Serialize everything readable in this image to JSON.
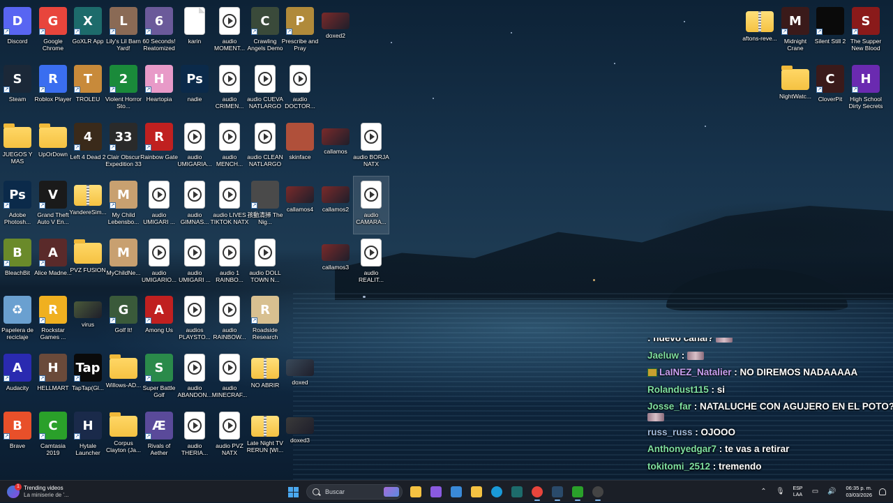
{
  "desktop": {
    "icons": [
      {
        "label": "Discord",
        "type": "app",
        "color": "#5865F2",
        "glyph": "D",
        "shortcut": true
      },
      {
        "label": "Google Chrome",
        "type": "app",
        "color": "#e8453c",
        "glyph": "G",
        "shortcut": true
      },
      {
        "label": "GoXLR App",
        "type": "app",
        "color": "#1d6b6b",
        "glyph": "X",
        "shortcut": true
      },
      {
        "label": "Lily's Lil Barn Yard!",
        "type": "app",
        "color": "#8a6a55",
        "glyph": "L",
        "shortcut": true
      },
      {
        "label": "60 Seconds! Reatomized",
        "type": "app",
        "color": "#6b5a9a",
        "glyph": "6",
        "shortcut": true
      },
      {
        "label": "karin",
        "type": "file",
        "color": "#ffffff",
        "glyph": ""
      },
      {
        "label": "audio MOMENT...",
        "type": "audio",
        "color": "#ffffff",
        "glyph": ""
      },
      {
        "label": "Crawling Angels Demo",
        "type": "app",
        "color": "#3a4a3a",
        "glyph": "C",
        "shortcut": true
      },
      {
        "label": "Prescribe and Pray",
        "type": "app",
        "color": "#b08a3a",
        "glyph": "P",
        "shortcut": true
      },
      {
        "label": "doxed2",
        "type": "thumb",
        "color": "#7a2a2a",
        "glyph": ""
      },
      {
        "label": "Steam",
        "type": "app",
        "color": "#1b2838",
        "glyph": "S",
        "shortcut": true
      },
      {
        "label": "Roblox Player",
        "type": "app",
        "color": "#3a6ef0",
        "glyph": "R",
        "shortcut": true
      },
      {
        "label": "TROLEU",
        "type": "app",
        "color": "#c88a3a",
        "glyph": "T",
        "shortcut": true
      },
      {
        "label": "Violent Horror Sto...",
        "type": "app",
        "color": "#1a8a3a",
        "glyph": "2",
        "shortcut": true
      },
      {
        "label": "Heartopia",
        "type": "app",
        "color": "#e89ac8",
        "glyph": "H",
        "shortcut": true
      },
      {
        "label": "nadie",
        "type": "app",
        "color": "#0b2a4a",
        "glyph": "Ps"
      },
      {
        "label": "audio CRIMEN...",
        "type": "audio",
        "color": "#ffffff",
        "glyph": ""
      },
      {
        "label": "audio CUEVA NATLARGO",
        "type": "audio",
        "color": "#ffffff",
        "glyph": ""
      },
      {
        "label": "audio DOCTOR...",
        "type": "audio",
        "color": "#ffffff",
        "glyph": ""
      },
      {
        "label": "JUEGOS Y MAS",
        "type": "folder",
        "color": "#f5c242",
        "glyph": ""
      },
      {
        "label": "UpOrDown",
        "type": "folder",
        "color": "#f5c242",
        "glyph": ""
      },
      {
        "label": "Left 4 Dead 2",
        "type": "app",
        "color": "#3a2a1a",
        "glyph": "4",
        "shortcut": true
      },
      {
        "label": "Clair Obscur Expedition 33",
        "type": "app",
        "color": "#2a2a2a",
        "glyph": "33",
        "shortcut": true
      },
      {
        "label": "Rainbow Gate",
        "type": "app",
        "color": "#c02020",
        "glyph": "R",
        "shortcut": true
      },
      {
        "label": "audio UMIGARIA...",
        "type": "audio",
        "color": "#ffffff",
        "glyph": ""
      },
      {
        "label": "audio MENCH...",
        "type": "audio",
        "color": "#ffffff",
        "glyph": ""
      },
      {
        "label": "audio CLEAN NATLARGO",
        "type": "audio",
        "color": "#ffffff",
        "glyph": ""
      },
      {
        "label": "skinface",
        "type": "app",
        "color": "#b0503a",
        "glyph": ""
      },
      {
        "label": "callamos",
        "type": "thumb",
        "color": "#7a2a2a",
        "glyph": ""
      },
      {
        "label": "audio BORJA NATX",
        "type": "audio",
        "color": "#ffffff",
        "glyph": ""
      },
      {
        "label": "Adobe Photosh...",
        "type": "app",
        "color": "#0b2a4a",
        "glyph": "Ps",
        "shortcut": true
      },
      {
        "label": "Grand Theft Auto V En...",
        "type": "app",
        "color": "#1a1a1a",
        "glyph": "V",
        "shortcut": true
      },
      {
        "label": "YandereSim...",
        "type": "zipfolder",
        "color": "#f5c242",
        "glyph": ""
      },
      {
        "label": "My Child Lebensbo...",
        "type": "app",
        "color": "#c8a070",
        "glyph": "M",
        "shortcut": true
      },
      {
        "label": "audio UMIGARI ...",
        "type": "audio",
        "color": "#ffffff",
        "glyph": ""
      },
      {
        "label": "audio GIMNAS...",
        "type": "audio",
        "color": "#ffffff",
        "glyph": ""
      },
      {
        "label": "audio LIVES TIKTOK NATX",
        "type": "audio",
        "color": "#ffffff",
        "glyph": ""
      },
      {
        "label": "孩動清掃 The Nig...",
        "type": "app",
        "color": "#4a4a4a",
        "glyph": "",
        "shortcut": true
      },
      {
        "label": "callamos4",
        "type": "thumb",
        "color": "#7a2a2a",
        "glyph": ""
      },
      {
        "label": "callamos2",
        "type": "thumb",
        "color": "#7a2a2a",
        "glyph": ""
      },
      {
        "label": "audio CAMARA...",
        "type": "audio",
        "color": "#ffffff",
        "glyph": "",
        "selected": true
      },
      {
        "label": "BleachBit",
        "type": "app",
        "color": "#6a8a2a",
        "glyph": "B",
        "shortcut": true
      },
      {
        "label": "Alice Madne...",
        "type": "app",
        "color": "#5a2a2a",
        "glyph": "A",
        "shortcut": true
      },
      {
        "label": "PVZ FUSION",
        "type": "folder",
        "color": "#f5c242",
        "glyph": ""
      },
      {
        "label": "MyChildNe...",
        "type": "app",
        "color": "#c8a070",
        "glyph": "M"
      },
      {
        "label": "audio UMIGARIO...",
        "type": "audio",
        "color": "#ffffff",
        "glyph": ""
      },
      {
        "label": "audio UMIGARI ...",
        "type": "audio",
        "color": "#ffffff",
        "glyph": ""
      },
      {
        "label": "audio 1 RAINBO...",
        "type": "audio",
        "color": "#ffffff",
        "glyph": ""
      },
      {
        "label": "audio DOLL TOWN N...",
        "type": "audio",
        "color": "#ffffff",
        "glyph": ""
      },
      {
        "label": "callamos3",
        "type": "thumb",
        "color": "#7a2a2a",
        "glyph": ""
      },
      {
        "label": "audio REALIT...",
        "type": "audio",
        "color": "#ffffff",
        "glyph": ""
      },
      {
        "label": "Papelera de reciclaje",
        "type": "app",
        "color": "#6aa0d0",
        "glyph": "♻"
      },
      {
        "label": "Rockstar Games ...",
        "type": "app",
        "color": "#f0b020",
        "glyph": "R",
        "shortcut": true
      },
      {
        "label": "virus",
        "type": "thumb",
        "color": "#4a5a3a",
        "glyph": ""
      },
      {
        "label": "Golf It!",
        "type": "app",
        "color": "#3a5a3a",
        "glyph": "G",
        "shortcut": true
      },
      {
        "label": "Among Us",
        "type": "app",
        "color": "#c02020",
        "glyph": "A",
        "shortcut": true
      },
      {
        "label": "audios PLAYSTO...",
        "type": "audio",
        "color": "#ffffff",
        "glyph": ""
      },
      {
        "label": "audio RAINBOW...",
        "type": "audio",
        "color": "#ffffff",
        "glyph": ""
      },
      {
        "label": "Roadside Research",
        "type": "app",
        "color": "#d8c090",
        "glyph": "R",
        "shortcut": true
      },
      {
        "label": "Audacity",
        "type": "app",
        "color": "#2a2ab0",
        "glyph": "A",
        "shortcut": true
      },
      {
        "label": "HELLMART",
        "type": "app",
        "color": "#6a4a3a",
        "glyph": "H",
        "shortcut": true
      },
      {
        "label": "TapTap(Gl...",
        "type": "app",
        "color": "#0a0a0a",
        "glyph": "Tap",
        "shortcut": true
      },
      {
        "label": "Willows-AD...",
        "type": "folder",
        "color": "#f5c242",
        "glyph": ""
      },
      {
        "label": "Super Battle Golf",
        "type": "app",
        "color": "#2a8a4a",
        "glyph": "S",
        "shortcut": true
      },
      {
        "label": "audio ABANDON...",
        "type": "audio",
        "color": "#ffffff",
        "glyph": ""
      },
      {
        "label": "audio MINECRAF...",
        "type": "audio",
        "color": "#ffffff",
        "glyph": ""
      },
      {
        "label": "NO ABRIR",
        "type": "zipfolder",
        "color": "#f5c242",
        "glyph": ""
      },
      {
        "label": "doxed",
        "type": "thumb",
        "color": "#3a4a5a",
        "glyph": ""
      },
      {
        "label": "Brave",
        "type": "app",
        "color": "#e8502a",
        "glyph": "B",
        "shortcut": true
      },
      {
        "label": "Camtasia 2019",
        "type": "app",
        "color": "#2aa02a",
        "glyph": "C",
        "shortcut": true
      },
      {
        "label": "Hytale Launcher",
        "type": "app",
        "color": "#1a2a4a",
        "glyph": "H",
        "shortcut": true
      },
      {
        "label": "Corpus Clayton (Ja...",
        "type": "folder",
        "color": "#f5c242",
        "glyph": ""
      },
      {
        "label": "Rivals of Aether",
        "type": "app",
        "color": "#5a4a9a",
        "glyph": "Æ",
        "shortcut": true
      },
      {
        "label": "audio THERIA...",
        "type": "audio",
        "color": "#ffffff",
        "glyph": ""
      },
      {
        "label": "audio PVZ NATX",
        "type": "audio",
        "color": "#ffffff",
        "glyph": ""
      },
      {
        "label": "Late Night TV RERUN [WI...",
        "type": "zipfolder",
        "color": "#f5c242",
        "glyph": ""
      },
      {
        "label": "doxed3",
        "type": "thumb",
        "color": "#3a3a3a",
        "glyph": ""
      },
      {
        "label": "aftons-reve...",
        "type": "zipfolder",
        "color": "#f5c242",
        "glyph": ""
      },
      {
        "label": "Midnight Crane",
        "type": "app",
        "color": "#3a1a1a",
        "glyph": "M",
        "shortcut": true
      },
      {
        "label": "Silent Still 2",
        "type": "app",
        "color": "#0a0a0a",
        "glyph": "",
        "shortcut": true
      },
      {
        "label": "The Supper New Blood",
        "type": "app",
        "color": "#8a1a1a",
        "glyph": "S",
        "shortcut": true
      },
      {
        "label": "NightWatc...",
        "type": "folder",
        "color": "#f5c242",
        "glyph": ""
      },
      {
        "label": "CloverPit",
        "type": "app",
        "color": "#3a1a1a",
        "glyph": "C",
        "shortcut": true
      },
      {
        "label": "High School Dirty Secrets",
        "type": "app",
        "color": "#6a2ab0",
        "glyph": "H",
        "shortcut": true
      }
    ]
  },
  "chat": {
    "messages": [
      {
        "user": "",
        "user_color": "#d02040",
        "text": ": nuevo canal?",
        "emote": true
      },
      {
        "user": "Jaeluw",
        "user_color": "#7fe0a0",
        "text": ":",
        "emote": true
      },
      {
        "user": "LaINEZ_Natalier",
        "user_color": "#c9a0f0",
        "text": ": NO DIREMOS NADAAAAA",
        "badge": true
      },
      {
        "user": "Rolandust115",
        "user_color": "#7fe0a0",
        "text": ": si"
      },
      {
        "user": "Josse_far",
        "user_color": "#7fe0a0",
        "text": ": NATALUCHE CON AGUJERO EN EL POTO?",
        "emote_below": true
      },
      {
        "user": "russ_russ",
        "user_color": "#a0b8d8",
        "text": ": OJOOO"
      },
      {
        "user": "Anthonyedgar7",
        "user_color": "#7fe0a0",
        "text": ": te vas a retirar"
      },
      {
        "user": "tokitomi_2512",
        "user_color": "#7fe0a0",
        "text": ": tremendo"
      }
    ]
  },
  "taskbar": {
    "widget": {
      "title": "Trending videos",
      "subtitle": "La miniserie de '...",
      "badge": "1"
    },
    "search_placeholder": "Buscar",
    "language": {
      "line1": "ESP",
      "line2": "LAA"
    },
    "clock": {
      "time": "06:35 p. m.",
      "date": "03/03/2026"
    },
    "apps": [
      {
        "name": "file-explorer",
        "color": "#f5c242"
      },
      {
        "name": "copilot",
        "color": "#8a5ae0"
      },
      {
        "name": "store",
        "color": "#3a8ad8"
      },
      {
        "name": "folder",
        "color": "#f5c242"
      },
      {
        "name": "edge",
        "color": "#1a9ad8"
      },
      {
        "name": "goxlr",
        "color": "#1d6b6b"
      },
      {
        "name": "chrome",
        "color": "#e8453c"
      },
      {
        "name": "steam",
        "color": "#2a4a6a"
      },
      {
        "name": "camtasia",
        "color": "#2aa02a"
      },
      {
        "name": "obs",
        "color": "#444444"
      }
    ]
  },
  "colors": {
    "taskbar_bg": "#1b1f27",
    "accent": "#7fb8f0"
  }
}
